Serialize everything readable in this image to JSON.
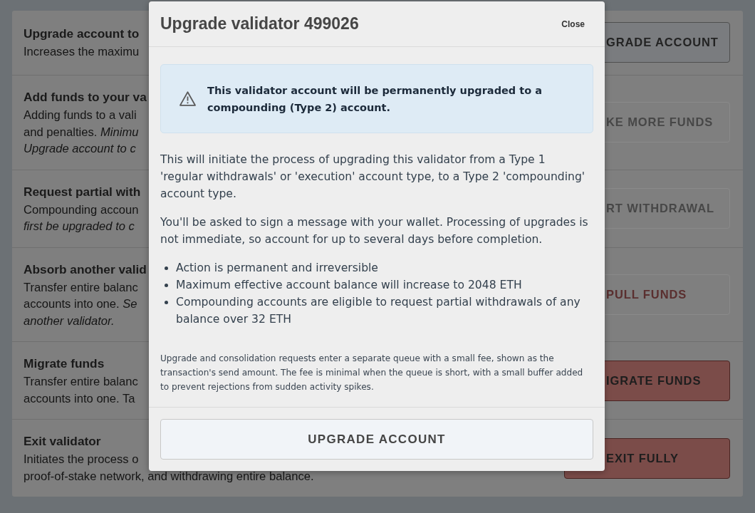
{
  "background_panel": {
    "cards": [
      {
        "title": "Upgrade account to",
        "description_lines": [
          "Increases the maximu"
        ],
        "button": {
          "label": "GRADE ACCOUNT",
          "kind": "default",
          "disabled": false
        }
      },
      {
        "title": "Add funds to your va",
        "description_lines": [
          "Adding funds to a vali",
          "and penalties. *Minimu*",
          "*Upgrade account to c*"
        ],
        "button": {
          "label": "KE MORE FUNDS",
          "kind": "default",
          "disabled": true
        }
      },
      {
        "title": "Request partial with",
        "description_lines": [
          "Compounding accoun",
          "*first be upgraded to c*"
        ],
        "button": {
          "label": "RT WITHDRAWAL",
          "kind": "default",
          "disabled": true
        }
      },
      {
        "title": "Absorb another valid",
        "description_lines": [
          "Transfer entire balanc",
          "accounts into one. *Se*",
          "*another validator.*"
        ],
        "button": {
          "label": "PULL FUNDS",
          "kind": "danger",
          "disabled": true
        }
      },
      {
        "title": "Migrate funds",
        "description_lines": [
          "Transfer entire balanc",
          "accounts into one. Ta"
        ],
        "button": {
          "label": "IGRATE FUNDS",
          "kind": "danger",
          "disabled": false
        }
      },
      {
        "title": "Exit validator",
        "description_lines": [
          "Initiates the process o",
          "proof-of-stake network, and withdrawing entire balance."
        ],
        "button": {
          "label": "EXIT FULLY",
          "kind": "danger",
          "disabled": false
        }
      }
    ]
  },
  "modal": {
    "title": "Upgrade validator 499026",
    "close_label": "Close",
    "alert": {
      "text": "This validator account will be permanently upgraded to a compounding (Type 2) account."
    },
    "paragraphs": [
      "This will initiate the process of upgrading this validator from a Type 1 'regular withdrawals' or 'execution' account type, to a Type 2 'compounding' account type.",
      "You'll be asked to sign a message with your wallet. Processing of upgrades is not immediate, so account for up to several days before completion."
    ],
    "bullets": [
      "Action is permanent and irreversible",
      "Maximum effective account balance will increase to 2048 ETH",
      "Compounding accounts are eligible to request partial withdrawals of any balance over 32 ETH"
    ],
    "note": "Upgrade and consolidation requests enter a separate queue with a small fee, shown as the transaction's send amount. The fee is minimal when the queue is short, with a small buffer added to prevent rejections from sudden activity spikes.",
    "primary_button": "UPGRADE ACCOUNT"
  }
}
